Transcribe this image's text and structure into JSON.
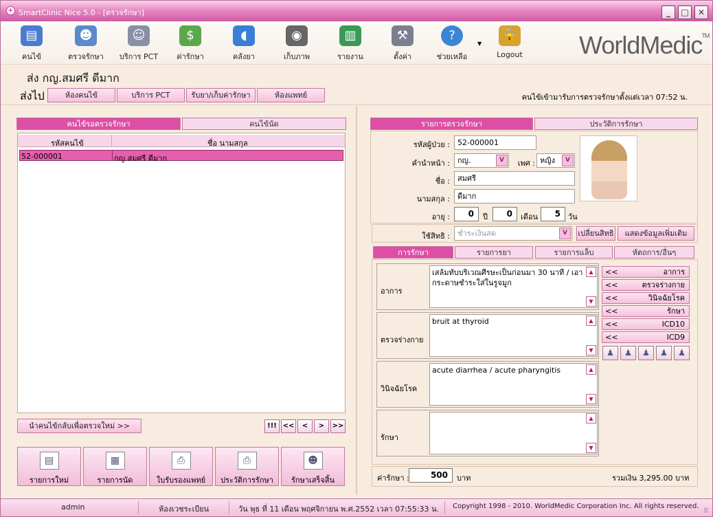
{
  "window": {
    "title": "SmartClinic Nice 5.0 - [ตรวจรักษา]",
    "brand": "WorldMedic",
    "brand_tm": "TM"
  },
  "toolbar": [
    {
      "label": "คนไข้",
      "icon": "patient-folder-icon",
      "color": "#4d7bd0"
    },
    {
      "label": "ตรวจรักษา",
      "icon": "doctor-icon",
      "color": "#5a8ac9"
    },
    {
      "label": "บริการ PCT",
      "icon": "masks-icon",
      "color": "#8a8fa8"
    },
    {
      "label": "ค่ารักษา",
      "icon": "money-icon",
      "color": "#5aa84a"
    },
    {
      "label": "คลังยา",
      "icon": "pill-icon",
      "color": "#3a7fd6"
    },
    {
      "label": "เก็บภาพ",
      "icon": "camera-icon",
      "color": "#666"
    },
    {
      "label": "รายงาน",
      "icon": "chart-icon",
      "color": "#3b9a54"
    },
    {
      "label": "ตั้งค่า",
      "icon": "tools-icon",
      "color": "#7b7f90"
    },
    {
      "label": "ช่วยเหลือ",
      "icon": "help-icon",
      "color": "#3a86d6"
    },
    {
      "label": "Logout",
      "icon": "lock-icon",
      "color": "#d8a230"
    }
  ],
  "patient_line": "ส่ง  กญ.สมศรี ดีมาก",
  "send": {
    "label": "ส่งไป",
    "buttons": [
      "ห้องคนไข้",
      "บริการ PCT",
      "รับยา/เก็บค่ารักษา",
      "ห้องแพทย์"
    ],
    "info": "คนไข้เข้ามารับการตรวจรักษาตั้งแต่เวลา  07:52 น."
  },
  "left": {
    "tabs": [
      "คนไข้รอตรวจรักษา",
      "คนไข้นัด"
    ],
    "columns": [
      "รหัสคนไข้",
      "ชื่อ นามสกุล"
    ],
    "rows": [
      {
        "id": "52-000001",
        "name": "กญ.สมศรี ดีมาก"
      }
    ],
    "return_button": "นำคนไข้กลับเพื่อตรวจใหม่ >>",
    "nav": [
      "!!!",
      "<<",
      "<",
      ">",
      ">>"
    ],
    "actions": [
      {
        "label": "รายการใหม่",
        "icon": "document-icon"
      },
      {
        "label": "รายการนัด",
        "icon": "calendar-icon"
      },
      {
        "label": "ใบรับรองแพทย์",
        "icon": "printer-icon"
      },
      {
        "label": "ประวัติการรักษา",
        "icon": "history-printer-icon"
      },
      {
        "label": "รักษาเสร็จสิ้น",
        "icon": "users-check-icon"
      }
    ]
  },
  "right": {
    "tabs": [
      "รายการตรวจรักษา",
      "ประวัติการรักษา"
    ],
    "patient": {
      "id_label": "รหัสผู้ป่วย :",
      "id": "52-000001",
      "prefix_label": "คำนำหน้า :",
      "prefix": "กญ.",
      "sex_label": "เพศ :",
      "sex": "หญิง",
      "name_label": "ชื่อ :",
      "name": "สมศรี",
      "surname_label": "นามสกุล :",
      "surname": "ดีมาก",
      "age_label": "อายุ :",
      "age_years": "0",
      "years_unit": "ปี",
      "age_months": "0",
      "months_unit": "เดือน",
      "age_days": "5",
      "days_unit": "วัน"
    },
    "rights": {
      "label": "ใช้สิทธิ :",
      "value": "ชำระเงินสด",
      "change_button": "เปลี่ยนสิทธิ",
      "more_button": "แสดงข้อมูลเพิ่มเติม"
    },
    "subtabs": [
      "การรักษา",
      "รายการยา",
      "รายการแล็บ",
      "หัตถการ/อื่นๆ"
    ],
    "records": [
      {
        "label": "อาการ",
        "text": "เสล้มทับบริเวณศีรษะเป็นก่อนมา 30 นาที / เอากระดาษชำระใส่ในรูจมูก"
      },
      {
        "label": "ตรวจร่างกาย",
        "text": "bruit at thyroid"
      },
      {
        "label": "วินิจฉัยโรค",
        "text": "acute diarrhea / acute pharyngitis"
      },
      {
        "label": "รักษา",
        "text": ""
      }
    ],
    "side_buttons": [
      {
        "arrow": "<<",
        "label": "อาการ"
      },
      {
        "arrow": "<<",
        "label": "ตรวจร่างกาย"
      },
      {
        "arrow": "<<",
        "label": "วินิจฉัยโรค"
      },
      {
        "arrow": "<<",
        "label": "รักษา"
      },
      {
        "arrow": "<<",
        "label": "ICD10"
      },
      {
        "arrow": "<<",
        "label": "ICD9"
      }
    ],
    "cost": {
      "label": "ค่ารักษา :",
      "value": "500",
      "unit": "บาท",
      "total": "รวมเงิน 3,295.00 บาท"
    }
  },
  "status": {
    "user": "admin",
    "room": "ห้องเวชระเบียน",
    "datetime": "วัน พุธ ที่ 11 เดือน พฤศจิกายน พ.ศ.2552 เวลา 07:55:33 น.",
    "copyright": "Copyright 1998 - 2010. WorldMedic Corporation Inc. All rights reserved."
  }
}
